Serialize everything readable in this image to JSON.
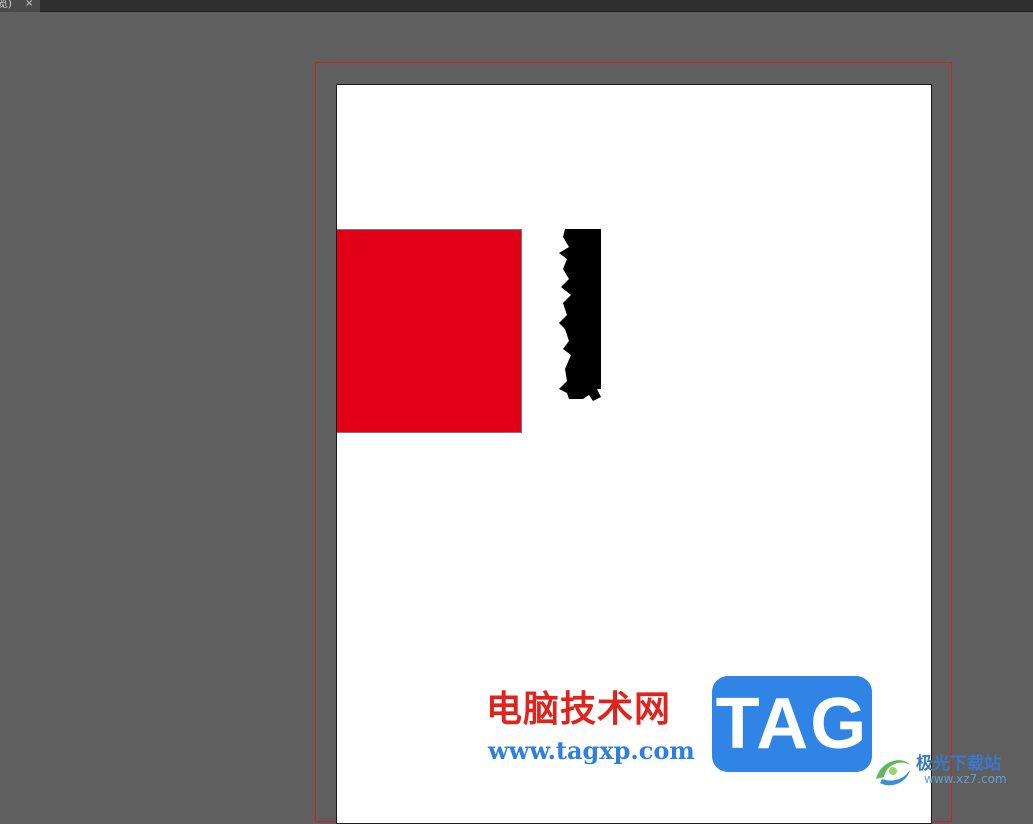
{
  "tab": {
    "title": "览)",
    "close_glyph": "×"
  },
  "canvas": {
    "background": "#5f5f5f",
    "bleed_color": "#d0212a",
    "page_background": "#ffffff"
  },
  "artwork": {
    "red_rect_color": "#e10015",
    "black_shape_color": "#000000"
  },
  "watermark": {
    "title": "电脑技术网",
    "url": "www.tagxp.com",
    "badge": "TAG",
    "title_color": "#e0241d",
    "url_color": "#2f7fe0",
    "badge_color": "#2f84e5"
  },
  "corner_logo": {
    "icon": "swirl-logo-icon",
    "name": "极光下载站",
    "url": "www.xz7.com"
  }
}
